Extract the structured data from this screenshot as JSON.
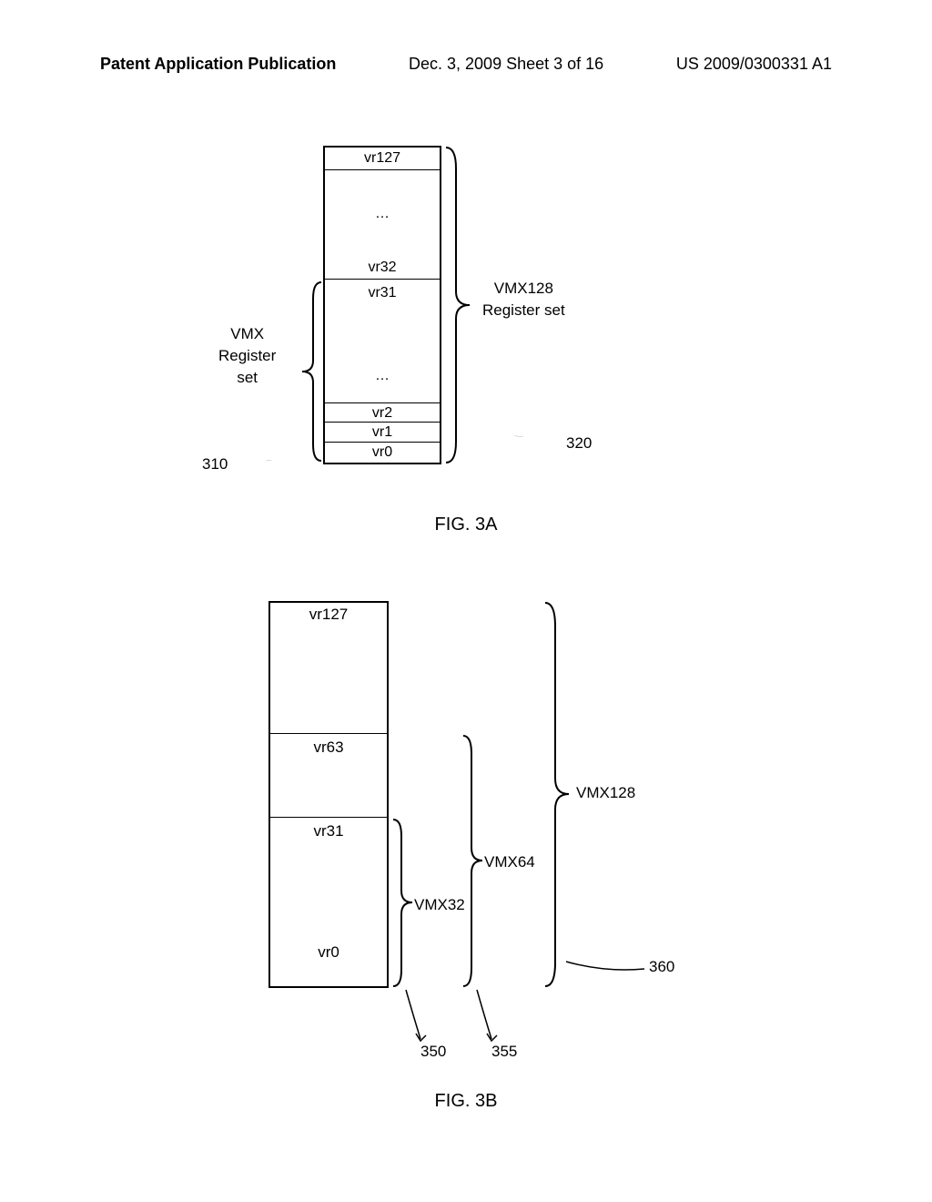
{
  "header": {
    "left": "Patent Application Publication",
    "center": "Dec. 3, 2009  Sheet 3 of 16",
    "right": "US 2009/0300331 A1"
  },
  "fig3a": {
    "registers": {
      "vr127": "vr127",
      "dots": "…",
      "vr32": "vr32",
      "vr31": "vr31",
      "vr2": "vr2",
      "vr1": "vr1",
      "vr0": "vr0"
    },
    "labels": {
      "vmx": "VMX\nRegister\nset",
      "vmx128": "VMX128\nRegister set"
    },
    "refs": {
      "ref310": "310",
      "ref320": "320"
    },
    "caption": "FIG. 3A"
  },
  "fig3b": {
    "registers": {
      "vr127": "vr127",
      "vr63": "vr63",
      "vr31": "vr31",
      "vr0": "vr0"
    },
    "labels": {
      "vmx32": "VMX32",
      "vmx64": "VMX64",
      "vmx128": "VMX128"
    },
    "refs": {
      "ref350": "350",
      "ref355": "355",
      "ref360": "360"
    },
    "caption": "FIG. 3B"
  }
}
